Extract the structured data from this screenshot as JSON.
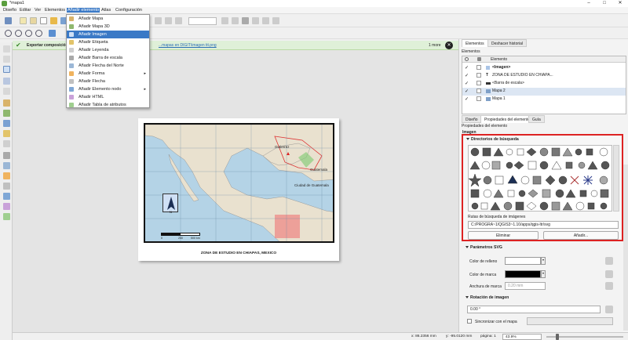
{
  "window": {
    "title": "*mapa1"
  },
  "menubar": {
    "items": [
      "Diseño",
      "Editar",
      "Ver",
      "Elementos",
      "Añadir elemento",
      "Atlas",
      "Configuración"
    ],
    "active": "Añadir elemento"
  },
  "dropdown": {
    "items": [
      {
        "label": "Añadir Mapa",
        "submenu": false
      },
      {
        "label": "Añadir Mapa 3D",
        "submenu": false
      },
      {
        "label": "Añadir Imagen",
        "submenu": false,
        "selected": true
      },
      {
        "label": "Añadir Etiqueta",
        "submenu": false
      },
      {
        "label": "Añadir Leyenda",
        "submenu": false
      },
      {
        "label": "Añadir Barra de escala",
        "submenu": false
      },
      {
        "label": "Añadir Flecha del Norte",
        "submenu": false
      },
      {
        "label": "Añadir Forma",
        "submenu": true
      },
      {
        "label": "Añadir Flecha",
        "submenu": false
      },
      {
        "label": "Añadir Elemento nodo",
        "submenu": true
      },
      {
        "label": "Añadir HTML",
        "submenu": false
      },
      {
        "label": "Añadir Tabla de atributos",
        "submenu": false
      }
    ]
  },
  "notification": {
    "title": "Exportar composición C",
    "link": "...mapas en DIGIT\\imagen tit.png",
    "more": "1 more"
  },
  "map": {
    "title": "ZONA DE ESTUDIO EN CHIAPAS, MEXICO",
    "labels": {
      "region": "Gutierrez",
      "region2": "Guatemala",
      "city": "Ciudad de Guatemala"
    },
    "scale": [
      "0",
      "250",
      "500 km"
    ]
  },
  "right_panel": {
    "top_tabs": [
      "Elementos",
      "Deshacer historial"
    ],
    "elements_title": "Elementos",
    "elements_col": "Elemento",
    "elements": [
      {
        "label": "<Imagen>",
        "bold": true
      },
      {
        "label": "ZONA DE ESTUDIO EN CHIAPA...",
        "bold": false
      },
      {
        "label": "<Barra de escala>",
        "bold": false
      },
      {
        "label": "Mapa 2",
        "bold": false
      },
      {
        "label": "Mapa 1",
        "bold": false
      }
    ],
    "prop_tabs": [
      "Diseño",
      "Propiedades del elemento",
      "Guía"
    ],
    "prop_title": "Propiedades del elemento",
    "image_label": "Imagen",
    "dir_header": "Directorios de búsqueda",
    "path_label": "Rutas de búsqueda de imágenes",
    "path_value": "C:/PROGRA~1/QGIS3~1.10/apps/qgis-ltr/svg",
    "btn_remove": "Eliminar",
    "btn_add": "Añadir...",
    "svg_header": "Parámetros SVG",
    "fill_label": "Color de relleno",
    "stroke_label": "Color de marca",
    "stroke_width_label": "Anchura de marca",
    "stroke_width_value": "0.20 mm",
    "rotation_header": "Rotación de imagen",
    "rotation_value": "0.00 °",
    "sync_label": "Sincronizar con el mapa"
  },
  "status": {
    "x": "x: 86.2356 mm",
    "y": "y: -95.0120 mm",
    "page": "página: 1",
    "zoom": "43.9%"
  }
}
